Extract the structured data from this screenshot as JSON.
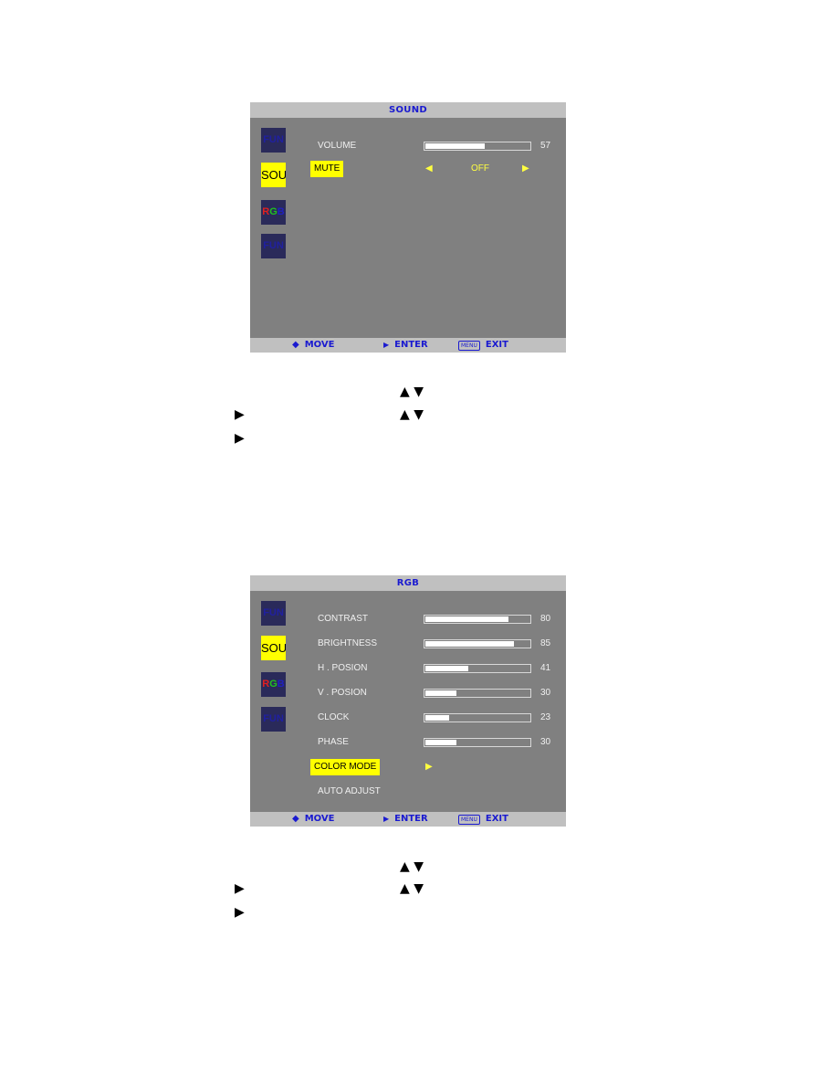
{
  "sound_menu": {
    "title": "SOUND",
    "tabs": [
      {
        "label": "FUN",
        "active": false
      },
      {
        "label": "SOU",
        "active": true
      },
      {
        "label": "RGB",
        "active": false
      },
      {
        "label": "FUN",
        "active": false
      }
    ],
    "rows": [
      {
        "label": "VOLUME",
        "value": 57,
        "value_text": "57",
        "selected": false
      },
      {
        "label": "MUTE",
        "option": "OFF",
        "selected": true
      }
    ],
    "footer": {
      "move": "MOVE",
      "enter": "ENTER",
      "menu_icon": "MENU",
      "exit": "EXIT"
    }
  },
  "rgb_menu": {
    "title": "RGB",
    "tabs": [
      {
        "label": "FUN",
        "active": false
      },
      {
        "label": "SOU",
        "active": true
      },
      {
        "label": "RGB",
        "active": false
      },
      {
        "label": "FUN",
        "active": false
      }
    ],
    "rows": [
      {
        "label": "CONTRAST",
        "value": 80,
        "value_text": "80"
      },
      {
        "label": "BRIGHTNESS",
        "value": 85,
        "value_text": "85"
      },
      {
        "label": "H . POSION",
        "value": 41,
        "value_text": "41"
      },
      {
        "label": "V . POSION",
        "value": 30,
        "value_text": "30"
      },
      {
        "label": "CLOCK",
        "value": 23,
        "value_text": "23"
      },
      {
        "label": "PHASE",
        "value": 30,
        "value_text": "30"
      },
      {
        "label": "COLOR MODE",
        "selected": true
      },
      {
        "label": "AUTO ADJUST"
      }
    ],
    "footer": {
      "move": "MOVE",
      "enter": "ENTER",
      "menu_icon": "MENU",
      "exit": "EXIT"
    }
  },
  "instructions": {
    "up_arrow": "▲",
    "down_arrow": "▼",
    "right_arrow": "▶"
  },
  "colors": {
    "osd_bg": "#808080",
    "title_bar": "#c0c0c0",
    "title_text": "#1a1ad0",
    "highlight": "#ffff00"
  }
}
